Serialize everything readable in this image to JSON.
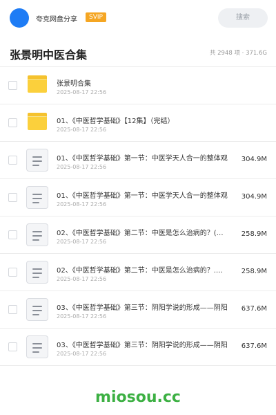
{
  "header": {
    "share_title": "夸克网盘分享",
    "badge": "SVIP",
    "search_label": "搜索",
    "accent_color": "#1e7cf5",
    "badge_color": "#f5a623"
  },
  "folder": {
    "title": "张景明中医合集",
    "stats": "共 2948 项 · 371.6G"
  },
  "files": [
    {
      "type": "folder",
      "name": "张景明合集",
      "date": "2025-08-17 22:56",
      "size": ""
    },
    {
      "type": "folder",
      "name": "01、《中医哲学基础》【12集】（完结）",
      "date": "2025-08-17 22:56",
      "size": ""
    },
    {
      "type": "doc",
      "name": "01、《中医哲学基础》第一节：中医学天人合一的整体观",
      "date": "2025-08-17 22:56",
      "size": "304.9M"
    },
    {
      "type": "doc",
      "name": "01、《中医哲学基础》第一节：中医学天人合一的整体观",
      "date": "2025-08-17 22:56",
      "size": "304.9M"
    },
    {
      "type": "doc",
      "name": "02、《中医哲学基础》第二节：中医是怎么治病的？(…",
      "date": "2025-08-17 22:56",
      "size": "258.9M"
    },
    {
      "type": "doc",
      "name": "02、《中医哲学基础》第二节：中医是怎么治病的？.…",
      "date": "2025-08-17 22:56",
      "size": "258.9M"
    },
    {
      "type": "doc",
      "name": "03、《中医哲学基础》第三节：阴阳学说的形成——阴阳",
      "date": "2025-08-17 22:56",
      "size": "637.6M"
    },
    {
      "type": "doc",
      "name": "03、《中医哲学基础》第三节：阴阳学说的形成——阴阳",
      "date": "2025-08-17 22:56",
      "size": "637.6M"
    }
  ],
  "watermark": "miosou.cc"
}
